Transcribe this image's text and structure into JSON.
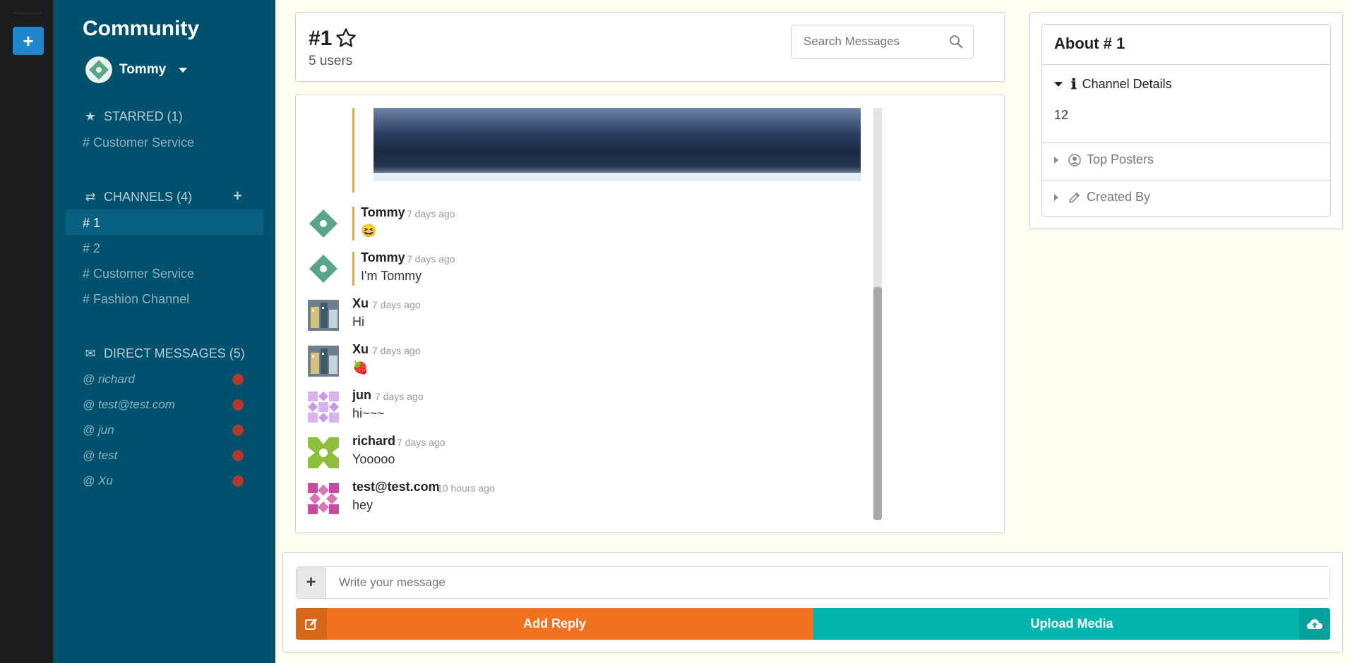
{
  "rail": {
    "add_label": "+"
  },
  "sidebar": {
    "app_title": "Community",
    "user_name": "Tommy",
    "starred": {
      "label": "STARRED (1)",
      "items": [
        "# Customer Service"
      ]
    },
    "channels": {
      "label": "CHANNELS (4)",
      "items": [
        "# 1",
        "# 2",
        "# Customer Service",
        "# Fashion Channel"
      ],
      "active": "# 1"
    },
    "direct_messages": {
      "label": "DIRECT MESSAGES (5)",
      "items": [
        "@ richard",
        "@ test@test.com",
        "@ jun",
        "@ test",
        "@ Xu"
      ]
    }
  },
  "header": {
    "channel_title": "#1",
    "users_count": "5 users",
    "search_placeholder": "Search Messages"
  },
  "messages": [
    {
      "author": "Tommy",
      "time": "7 days ago",
      "text": "😆",
      "avatar": "tommy"
    },
    {
      "author": "Tommy",
      "time": "7 days ago",
      "text": "I'm Tommy",
      "avatar": "tommy"
    },
    {
      "author": "Xu",
      "time": "7 days ago",
      "text": "Hi",
      "avatar": "xu"
    },
    {
      "author": "Xu",
      "time": "7 days ago",
      "text": "🍓",
      "avatar": "xu"
    },
    {
      "author": "jun",
      "time": "7 days ago",
      "text": "hi~~~",
      "avatar": "jun"
    },
    {
      "author": "richard",
      "time": "7 days ago",
      "text": "Yooooo",
      "avatar": "richard"
    },
    {
      "author": "test@test.com",
      "time": "10 hours ago",
      "text": "hey",
      "avatar": "test"
    }
  ],
  "about": {
    "title": "About # 1",
    "channel_details": "Channel Details",
    "channel_details_value": "12",
    "top_posters": "Top Posters",
    "created_by": "Created By"
  },
  "composer": {
    "placeholder": "Write your message",
    "plus_label": "+",
    "reply_label": "Add Reply",
    "upload_label": "Upload Media"
  },
  "colors": {
    "sidebar_bg": "#00516e",
    "rail_bg": "#1c1c1c",
    "reply_button": "#f2711c",
    "upload_button": "#00b5ad",
    "accent_line": "#f2a529",
    "dm_status": "#b03a2e"
  }
}
